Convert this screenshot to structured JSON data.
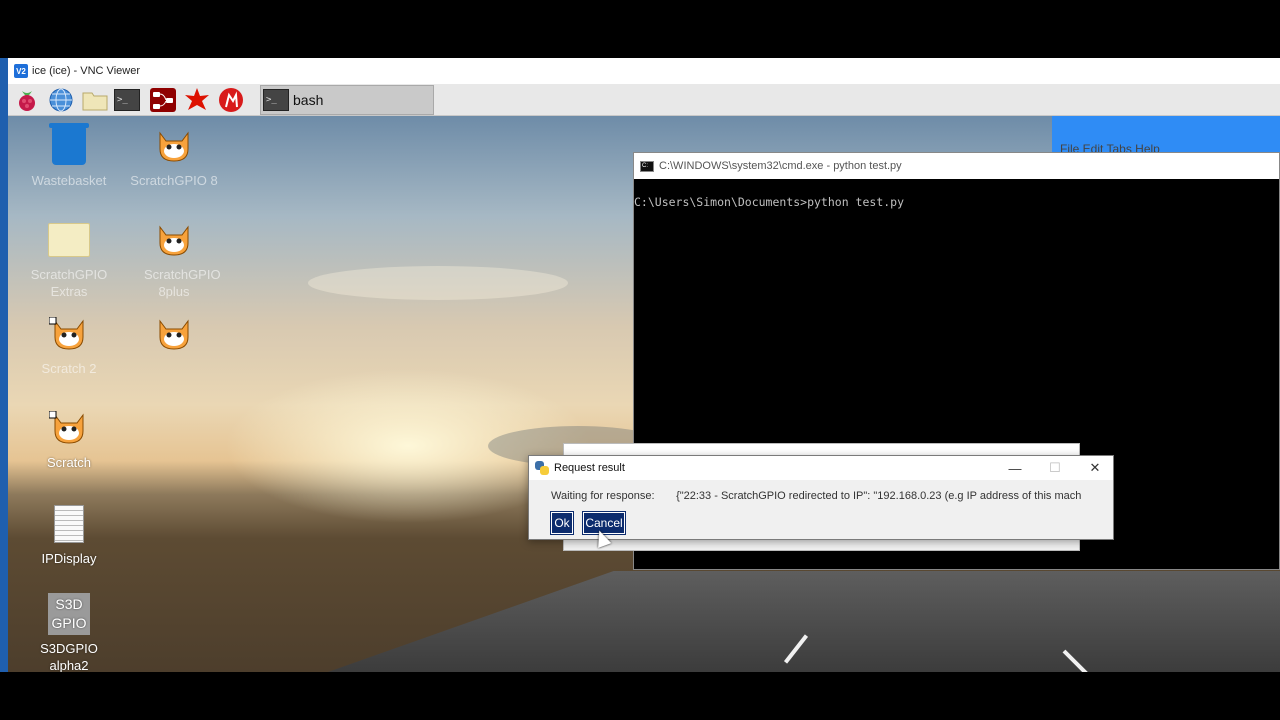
{
  "vnc": {
    "title": "ice (ice) - VNC Viewer",
    "logo": "V2"
  },
  "taskbar": {
    "icons": [
      "raspberry-icon",
      "globe-icon",
      "folder-icon",
      "terminal-icon",
      "nodered-icon",
      "wolfram-icon",
      "mathematica-icon"
    ],
    "bash_label": "bash",
    "terminal_glyph": ">_"
  },
  "desktop": {
    "icons": [
      {
        "label": "Wastebasket",
        "faint": true
      },
      {
        "label": "ScratchGPIO 8",
        "faint": true
      },
      {
        "label": "ScratchGPIO Extras",
        "faint": true
      },
      {
        "label": "ScratchGPIO 8plus",
        "faint": true
      },
      {
        "label": "Scratch 2",
        "faint": true
      },
      {
        "label": "",
        "faint": true
      },
      {
        "label": "Scratch",
        "faint": false
      },
      {
        "label": "IPDisplay",
        "faint": false
      },
      {
        "label": "S3DGPIO alpha2",
        "faint": false
      }
    ],
    "s3d_line1": "S3D",
    "s3d_line2": "GPIO"
  },
  "blue_app": {
    "menu": "File  Edit  Tabs  Help"
  },
  "cmd": {
    "title": "C:\\WINDOWS\\system32\\cmd.exe - python  test.py",
    "line1": "C:\\Users\\Simon\\Documents>python test.py"
  },
  "dialog": {
    "title": "Request result",
    "label": "Waiting for response:",
    "message": "{\"22:33 - ScratchGPIO redirected to IP\": \"192.168.0.23 (e.g IP address of this mach",
    "ok_label": "Ok",
    "cancel_label": "Cancel",
    "minimize": "—",
    "maximize": "☐",
    "close": "✕"
  }
}
